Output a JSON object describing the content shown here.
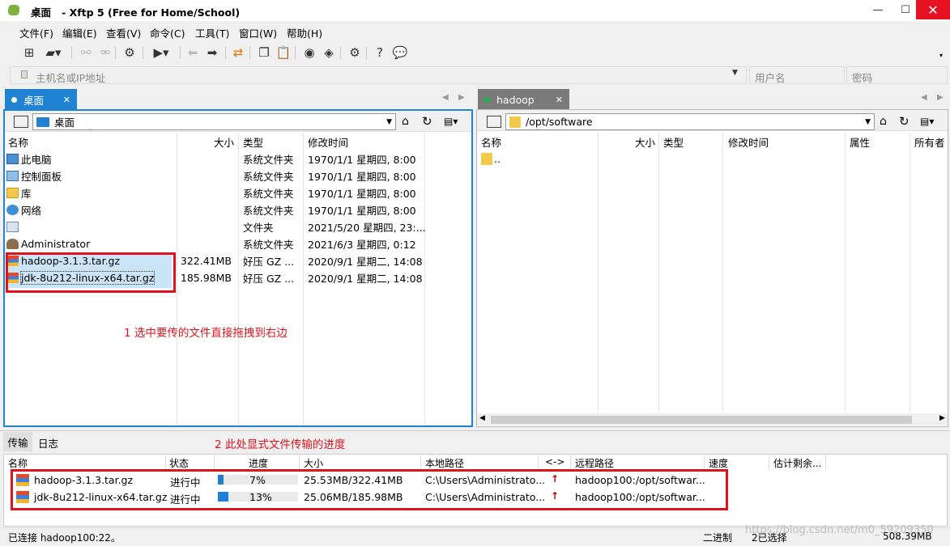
{
  "window": {
    "title": "桌面",
    "app_title": "   - Xftp 5 (Free for Home/School)",
    "min": "—",
    "max": "☐",
    "close": "✕"
  },
  "menu": [
    "文件(F)",
    "编辑(E)",
    "查看(V)",
    "命令(C)",
    "工具(T)",
    "窗口(W)",
    "帮助(H)"
  ],
  "address": {
    "placeholder": "主机名或IP地址",
    "user_placeholder": "用户名",
    "pass_placeholder": "密码"
  },
  "local": {
    "tab": "桌面",
    "path": "桌面",
    "columns": [
      "名称",
      "大小",
      "类型",
      "修改时间"
    ],
    "rows": [
      {
        "name": "此电脑",
        "size": "",
        "type": "系统文件夹",
        "mtime": "1970/1/1 星期四, 8:00",
        "icon": "computer-icon"
      },
      {
        "name": "控制面板",
        "size": "",
        "type": "系统文件夹",
        "mtime": "1970/1/1 星期四, 8:00",
        "icon": "control-panel-icon"
      },
      {
        "name": "库",
        "size": "",
        "type": "系统文件夹",
        "mtime": "1970/1/1 星期四, 8:00",
        "icon": "library-icon"
      },
      {
        "name": "网络",
        "size": "",
        "type": "系统文件夹",
        "mtime": "1970/1/1 星期四, 8:00",
        "icon": "network-icon"
      },
      {
        "name": "",
        "size": "",
        "type": "文件夹",
        "mtime": "2021/5/20 星期四, 23:...",
        "icon": "folder-icon"
      },
      {
        "name": "Administrator",
        "size": "",
        "type": "系统文件夹",
        "mtime": "2021/6/3 星期四, 0:12",
        "icon": "user-icon"
      },
      {
        "name": "hadoop-3.1.3.tar.gz",
        "size": "322.41MB",
        "type": "好压 GZ ...",
        "mtime": "2020/9/1 星期二, 14:08",
        "icon": "archive-icon"
      },
      {
        "name": "jdk-8u212-linux-x64.tar.gz",
        "size": "185.98MB",
        "type": "好压 GZ ...",
        "mtime": "2020/9/1 星期二, 14:08",
        "icon": "archive-icon"
      }
    ],
    "annotation": "1 选中要传的文件直接拖拽到右边"
  },
  "remote": {
    "tab": "hadoop",
    "path": "/opt/software",
    "columns": [
      "名称",
      "大小",
      "类型",
      "修改时间",
      "属性",
      "所有者"
    ],
    "rows": [
      {
        "name": ".."
      }
    ]
  },
  "bottom": {
    "tabs": [
      "传输",
      "日志"
    ],
    "annotation": "2 此处显式文件传输的进度",
    "columns": [
      "名称",
      "状态",
      "进度",
      "大小",
      "本地路径",
      "<->",
      "远程路径",
      "速度",
      "估计剩余..."
    ],
    "transfers": [
      {
        "name": "hadoop-3.1.3.tar.gz",
        "status": "进行中",
        "progress": "7%",
        "progress_value": 0.07,
        "size": "25.53MB/322.41MB",
        "local": "C:\\Users\\Administrato...",
        "dir": "upload-arrow-icon",
        "remote": "hadoop100:/opt/softwar..."
      },
      {
        "name": "jdk-8u212-linux-x64.tar.gz",
        "status": "进行中",
        "progress": "13%",
        "progress_value": 0.13,
        "size": "25.06MB/185.98MB",
        "local": "C:\\Users\\Administrato...",
        "dir": "upload-arrow-icon",
        "remote": "hadoop100:/opt/softwar..."
      }
    ]
  },
  "status": {
    "left": "已连接 hadoop100:22。",
    "mode": "二进制",
    "selected": "2已选择",
    "size": "508.39MB"
  },
  "watermark": "https://blog.csdn.net/m0_59209350",
  "colors": {
    "accent": "#1f82d2",
    "annotation": "#e0121c",
    "remote_dot": "#22b14c"
  }
}
